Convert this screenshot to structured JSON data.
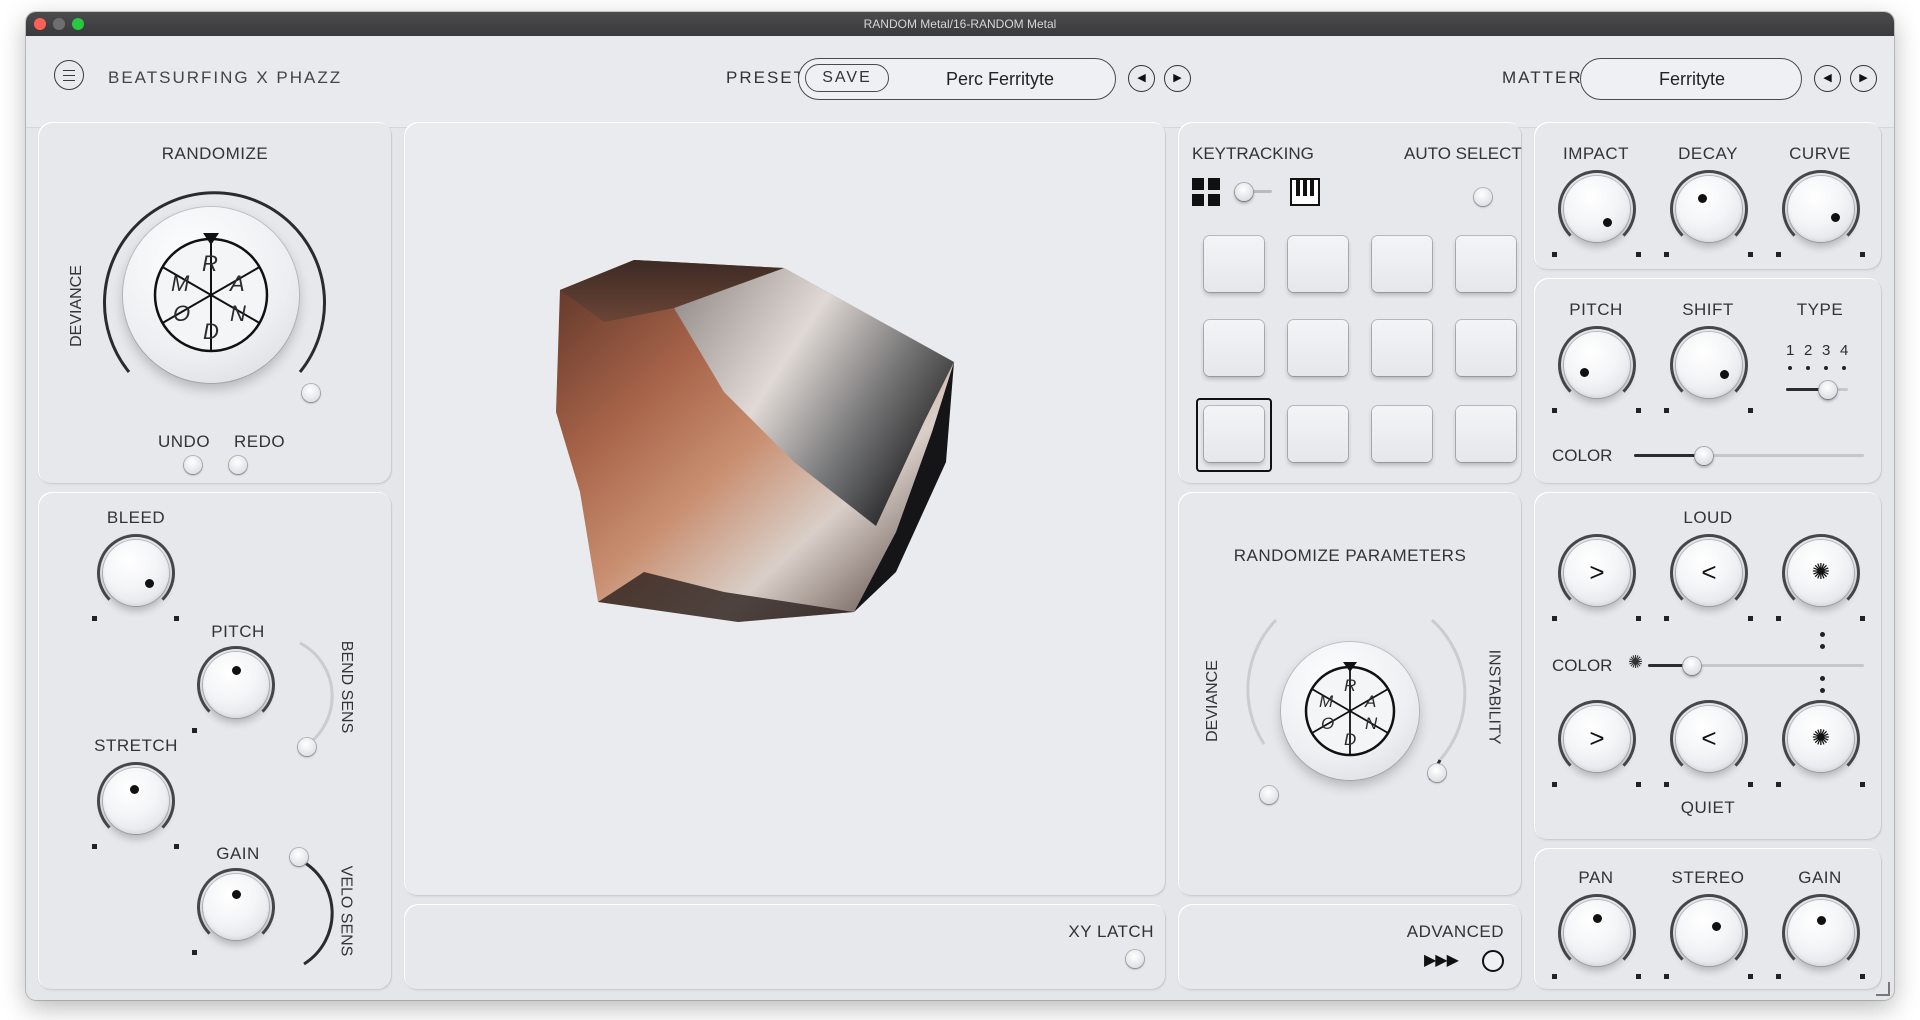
{
  "window": {
    "title": "RANDOM Metal/16-RANDOM Metal"
  },
  "header": {
    "brand": "BEATSURFING X PHAZZ",
    "preset_label": "PRESET",
    "save_label": "SAVE",
    "preset_value": "Perc Ferrityte",
    "matter_label": "MATTER",
    "matter_value": "Ferrityte",
    "prev_glyph": "◀",
    "next_glyph": "▶"
  },
  "randomize": {
    "title": "RANDOMIZE",
    "deviance_label": "DEVIANCE",
    "undo_label": "UNDO",
    "redo_label": "REDO",
    "letters": [
      "R",
      "A",
      "N",
      "D",
      "O",
      "M"
    ]
  },
  "left_knobs": {
    "bleed_label": "BLEED",
    "pitch_label": "PITCH",
    "bend_sens_label": "BEND SENS",
    "stretch_label": "STRETCH",
    "gain_label": "GAIN",
    "velo_sens_label": "VELO SENS"
  },
  "xy": {
    "latch_label": "XY LATCH"
  },
  "keytracking": {
    "label": "KEYTRACKING",
    "auto_select_label": "AUTO SELECT",
    "pads_rows": 3,
    "pads_cols": 4,
    "selected_pad": 8
  },
  "randomize_params": {
    "title": "RANDOMIZE PARAMETERS",
    "deviance_label": "DEVIANCE",
    "instability_label": "INSTABILITY",
    "letters": [
      "R",
      "A",
      "N",
      "D",
      "O",
      "M"
    ]
  },
  "advanced": {
    "label": "ADVANCED",
    "glyph": "▶▶▶"
  },
  "envelope": {
    "impact_label": "IMPACT",
    "decay_label": "DECAY",
    "curve_label": "CURVE"
  },
  "tone": {
    "pitch_label": "PITCH",
    "shift_label": "SHIFT",
    "type_label": "TYPE",
    "type_options": [
      "1",
      "2",
      "3",
      "4"
    ],
    "color_label": "COLOR"
  },
  "dynamics": {
    "loud_label": "LOUD",
    "color_label": "COLOR",
    "quiet_label": "QUIET"
  },
  "output": {
    "pan_label": "PAN",
    "stereo_label": "STEREO",
    "gain_label": "GAIN"
  },
  "colors": {
    "accent": "#2b2b2d",
    "panel": "#e6e8ec",
    "background": "#e4e6ea"
  }
}
